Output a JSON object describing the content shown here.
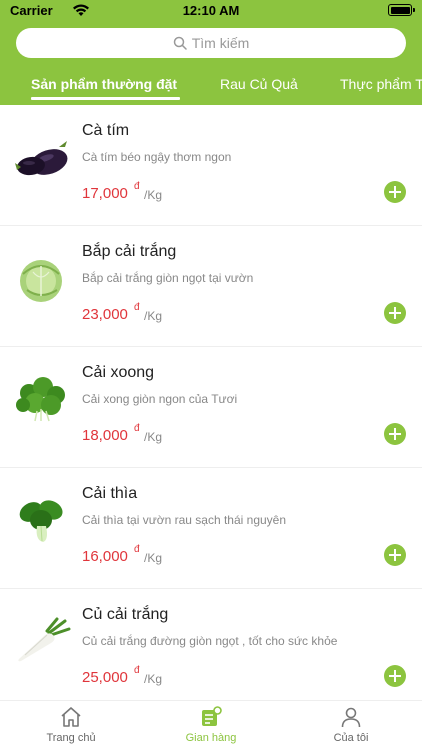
{
  "status_bar": {
    "carrier": "Carrier",
    "time": "12:10 AM"
  },
  "search": {
    "placeholder": "Tìm kiếm"
  },
  "tabs": [
    {
      "label": "Sản phẩm thường đặt",
      "active": true
    },
    {
      "label": "Rau Củ Quả",
      "active": false
    },
    {
      "label": "Thực phẩm T",
      "active": false
    }
  ],
  "products": [
    {
      "name": "Cà tím",
      "description": "Cà tím béo ngậy thơm ngon",
      "price": "17,000",
      "currency": "đ",
      "unit": "/Kg",
      "icon": "eggplant-image"
    },
    {
      "name": "Bắp cải trắng",
      "description": "Bắp cải trắng giòn ngọt tại vườn",
      "price": "23,000",
      "currency": "đ",
      "unit": "/Kg",
      "icon": "cabbage-image"
    },
    {
      "name": "Cải xoong",
      "description": "Cải xong giòn ngon của Tươi",
      "price": "18,000",
      "currency": "đ",
      "unit": "/Kg",
      "icon": "watercress-image"
    },
    {
      "name": "Cải thìa",
      "description": "Cải thìa tại vườn rau sạch thái nguyên",
      "price": "16,000",
      "currency": "đ",
      "unit": "/Kg",
      "icon": "bok-choy-image"
    },
    {
      "name": "Củ cải trắng",
      "description": "Củ cải trắng đường giòn ngọt , tốt cho sức khỏe",
      "price": "25,000",
      "currency": "đ",
      "unit": "/Kg",
      "icon": "daikon-image"
    }
  ],
  "tab_bar": [
    {
      "label": "Trang chủ",
      "icon": "home-icon",
      "active": false
    },
    {
      "label": "Gian hàng",
      "icon": "store-icon",
      "active": true
    },
    {
      "label": "Của tôi",
      "icon": "user-icon",
      "active": false
    }
  ],
  "colors": {
    "primary": "#8cc43f",
    "price": "#e0353b"
  }
}
